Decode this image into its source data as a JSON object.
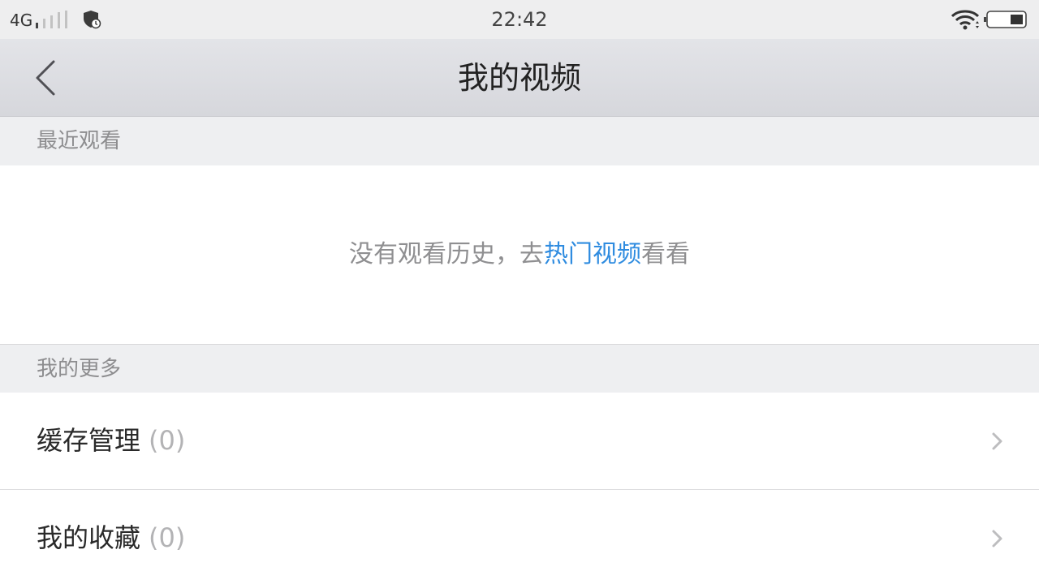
{
  "status_bar": {
    "network": "4G",
    "time": "22:42",
    "icons": [
      "signal-icon",
      "shield-icon",
      "wifi-icon",
      "battery-icon"
    ]
  },
  "header": {
    "title": "我的视频",
    "back_icon": "back-arrow-icon"
  },
  "recent": {
    "section_label": "最近观看",
    "empty_prefix": "没有观看历史，去",
    "empty_link": "热门视频",
    "empty_suffix": "看看"
  },
  "more": {
    "section_label": "我的更多",
    "items": [
      {
        "label": "缓存管理",
        "count": "(0)"
      },
      {
        "label": "我的收藏",
        "count": "(0)"
      }
    ]
  },
  "colors": {
    "link": "#2f8ce0",
    "title_text": "#222222",
    "muted_text": "#8f8f91"
  }
}
